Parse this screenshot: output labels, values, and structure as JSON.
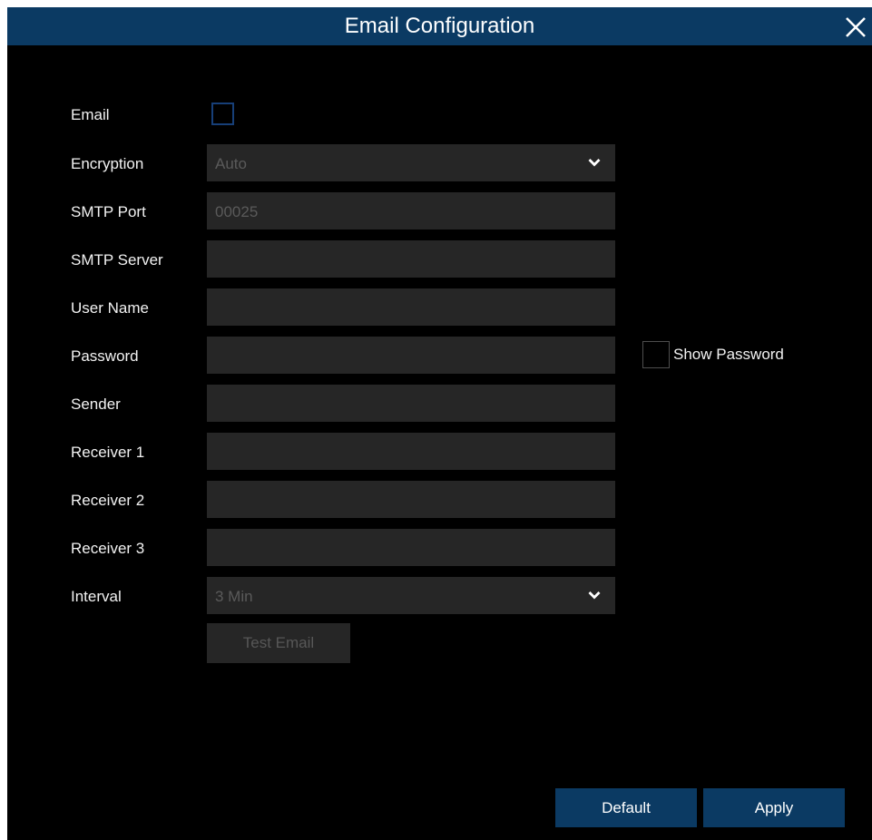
{
  "dialog": {
    "title": "Email Configuration",
    "close_icon": "close-icon"
  },
  "form": {
    "email_label": "Email",
    "email_checked": false,
    "encryption_label": "Encryption",
    "encryption_value": "Auto",
    "smtp_port_label": "SMTP Port",
    "smtp_port_value": "00025",
    "smtp_server_label": "SMTP Server",
    "smtp_server_value": "",
    "user_name_label": "User Name",
    "user_name_value": "",
    "password_label": "Password",
    "password_value": "",
    "show_password_label": "Show Password",
    "show_password_checked": false,
    "sender_label": "Sender",
    "sender_value": "",
    "receiver1_label": "Receiver 1",
    "receiver1_value": "",
    "receiver2_label": "Receiver 2",
    "receiver2_value": "",
    "receiver3_label": "Receiver 3",
    "receiver3_value": "",
    "interval_label": "Interval",
    "interval_value": "3 Min",
    "test_email_label": "Test Email"
  },
  "footer": {
    "default_label": "Default",
    "apply_label": "Apply"
  },
  "colors": {
    "title_bar": "#0b3a63",
    "background": "#000000",
    "field_background": "#262626",
    "checkbox_border_accent": "#173f78"
  }
}
